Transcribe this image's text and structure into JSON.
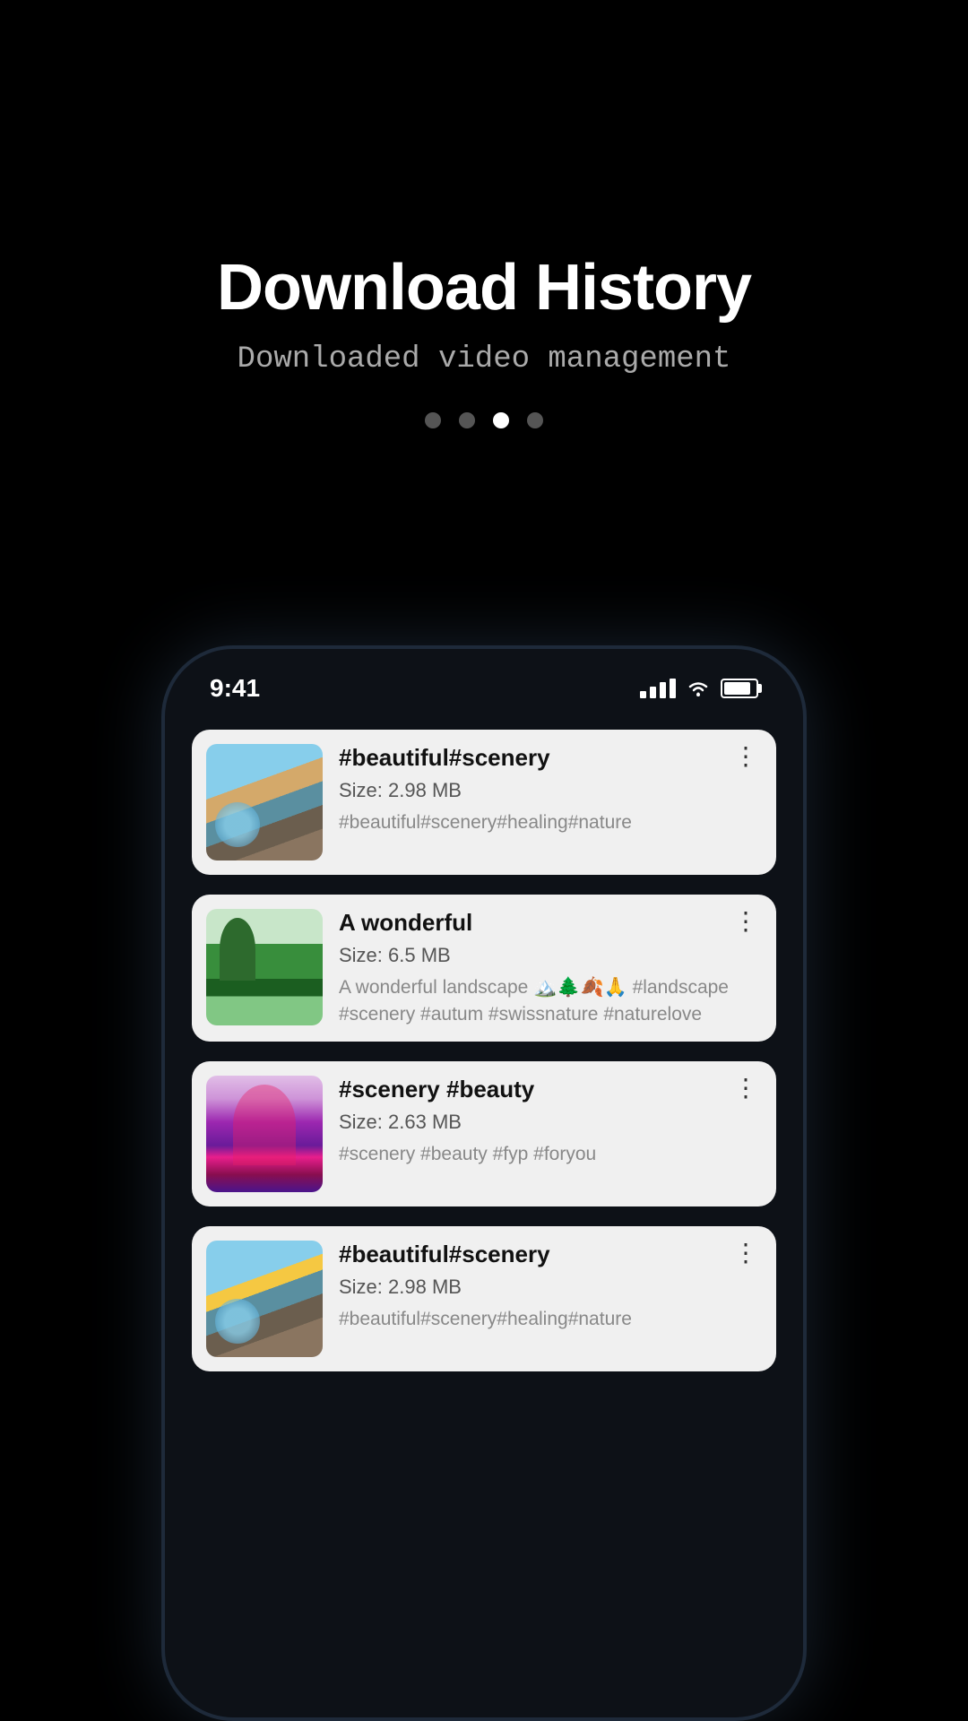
{
  "hero": {
    "title": "Download History",
    "subtitle": "Downloaded video management",
    "dots": [
      {
        "id": 1,
        "active": false
      },
      {
        "id": 2,
        "active": false
      },
      {
        "id": 3,
        "active": true
      },
      {
        "id": 4,
        "active": false
      }
    ]
  },
  "phone": {
    "status_bar": {
      "time": "9:41",
      "signal_label": "signal",
      "wifi_label": "wifi",
      "battery_label": "battery"
    },
    "videos": [
      {
        "id": 1,
        "title": "#beautiful#scenery",
        "size_label": "Size:",
        "size_value": "2.98 MB",
        "tags": "#beautiful#scenery#healing#nature",
        "thumb_type": "beach"
      },
      {
        "id": 2,
        "title": "A wonderful",
        "size_label": "Size:",
        "size_value": "6.5 MB",
        "tags": "A wonderful landscape 🏔️🌲🍂🙏 #landscape #scenery #autum #swissnature #naturelove",
        "thumb_type": "landscape"
      },
      {
        "id": 3,
        "title": "#scenery #beauty",
        "size_label": "Size:",
        "size_value": "2.63 MB",
        "tags": "#scenery #beauty #fyp #foryou",
        "thumb_type": "purple"
      },
      {
        "id": 4,
        "title": "#beautiful#scenery",
        "size_label": "Size:",
        "size_value": "2.98 MB",
        "tags": "#beautiful#scenery#healing#nature",
        "thumb_type": "beach2"
      }
    ],
    "more_button_label": "⋮"
  }
}
